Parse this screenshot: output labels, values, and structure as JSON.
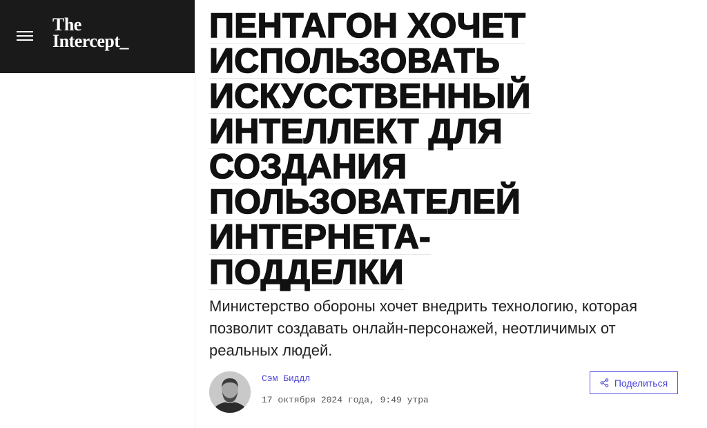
{
  "header": {
    "logo_line1": "The",
    "logo_line2": "Intercept_",
    "background": "#1a1a1a"
  },
  "article": {
    "headline_lines": [
      "ПЕНТАГОН ХОЧЕТ",
      "ИСПОЛЬЗОВАТЬ",
      "ИСКУССТВЕННЫЙ",
      "ИНТЕЛЛЕКТ ДЛЯ",
      "СОЗДАНИЯ",
      "ПОЛЬЗОВАТЕЛЕЙ",
      "ИНТЕРНЕТА-",
      "ПОДДЕЛКИ"
    ],
    "dek": "Министерство обороны хочет внедрить технологию, которая позволит создавать онлайн-персонажей, неотличимых от реальных людей.",
    "author": "Сэм Биддл",
    "date": "17 октября 2024 года, 9:49 утра",
    "share_label": "Поделиться"
  },
  "icons": {
    "menu": "hamburger-icon",
    "share": "share-icon",
    "avatar": "author-photo"
  },
  "colors": {
    "accent": "#4b45d6",
    "text": "#111111"
  }
}
